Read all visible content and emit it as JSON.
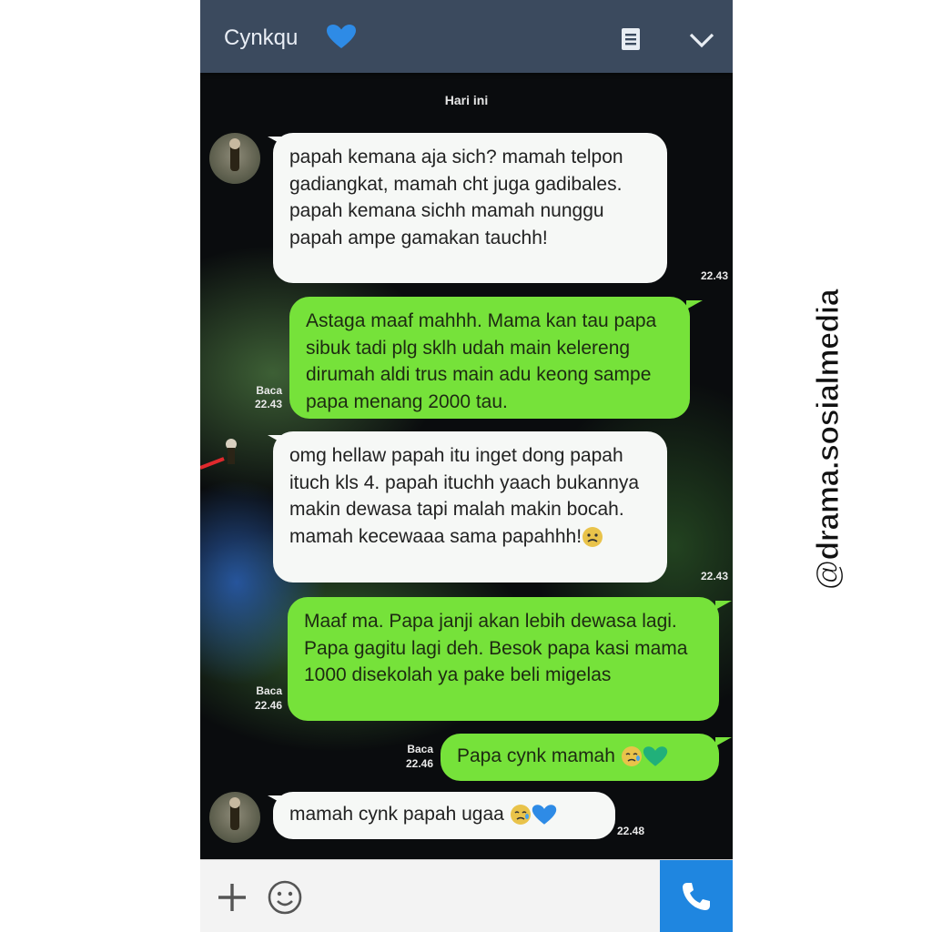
{
  "header": {
    "contact_name": "Cynkqu",
    "contact_icon": "blue-heart-icon",
    "menu_icon": "notes-icon",
    "expand_icon": "chevron-down-icon"
  },
  "date_label": "Hari ini",
  "messages": [
    {
      "direction": "incoming",
      "text": "papah kemana aja sich? mamah telpon gadiangkat, mamah cht juga gadibales. papah kemana sichh mamah nunggu papah ampe gamakan tauchh!",
      "read": "",
      "time": "22.43"
    },
    {
      "direction": "outgoing",
      "text": "Astaga maaf mahhh. Mama kan tau papa sibuk tadi plg sklh udah main kelereng dirumah aldi trus main adu keong sampe papa menang 2000 tau.",
      "read": "Baca",
      "time": "22.43"
    },
    {
      "direction": "incoming",
      "text": "omg hellaw papah itu inget dong papah ituch kls 4. papah ituchh yaach bukannya makin dewasa tapi malah makin bocah. mamah kecewaaa sama papahhh!",
      "emoji": "sad-face",
      "read": "",
      "time": "22.43"
    },
    {
      "direction": "outgoing",
      "text": "Maaf ma.  Papa janji akan lebih dewasa lagi.  Papa gagitu lagi deh.  Besok papa kasi mama 1000 disekolah ya pake beli migelas",
      "read": "Baca",
      "time": "22.46"
    },
    {
      "direction": "outgoing",
      "text": "Papa cynk mamah",
      "emoji": "crying-face green-heart",
      "read": "Baca",
      "time": "22.46"
    },
    {
      "direction": "incoming",
      "text": "mamah cynk papah ugaa",
      "emoji": "crying-face blue-heart",
      "read": "",
      "time": "22.48"
    }
  ],
  "input_bar": {
    "add_icon": "plus-icon",
    "emoji_icon": "smiley-icon",
    "call_icon": "phone-icon"
  },
  "watermark": "@drama.sosialmedia",
  "colors": {
    "header": "#3b4a5e",
    "incoming_bubble": "#f6f8f6",
    "outgoing_bubble": "#76e23a",
    "call_button": "#1f86e0",
    "heart_blue": "#2e8be6",
    "heart_green": "#21b07a"
  }
}
